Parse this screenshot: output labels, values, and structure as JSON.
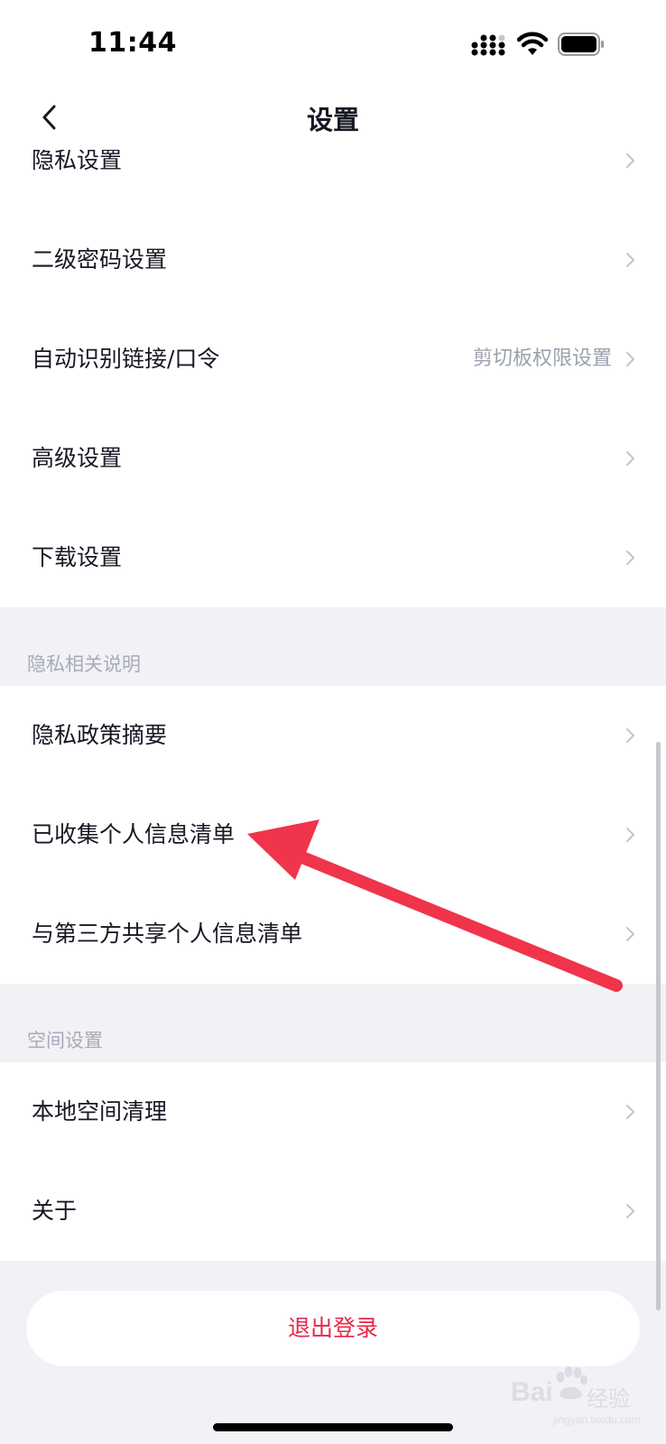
{
  "status_bar": {
    "time": "11:44"
  },
  "nav": {
    "title": "设置"
  },
  "settings_group": [
    {
      "label": "隐私设置",
      "hint": ""
    },
    {
      "label": "二级密码设置",
      "hint": ""
    },
    {
      "label": "自动识别链接/口令",
      "hint": "剪切板权限设置"
    },
    {
      "label": "高级设置",
      "hint": ""
    },
    {
      "label": "下载设置",
      "hint": ""
    }
  ],
  "privacy_section": {
    "title": "隐私相关说明",
    "items": [
      {
        "label": "隐私政策摘要"
      },
      {
        "label": "已收集个人信息清单"
      },
      {
        "label": "与第三方共享个人信息清单"
      }
    ]
  },
  "space_section": {
    "title": "空间设置",
    "items": [
      {
        "label": "本地空间清理"
      },
      {
        "label": "关于"
      }
    ]
  },
  "logout_label": "退出登录",
  "watermark": {
    "brand": "Bai",
    "cn": "经验",
    "sub": "jingyan.baidu.com"
  },
  "colors": {
    "accent": "#e8264a",
    "annotation_arrow": "#f0344b",
    "background": "#f1f1f6"
  }
}
